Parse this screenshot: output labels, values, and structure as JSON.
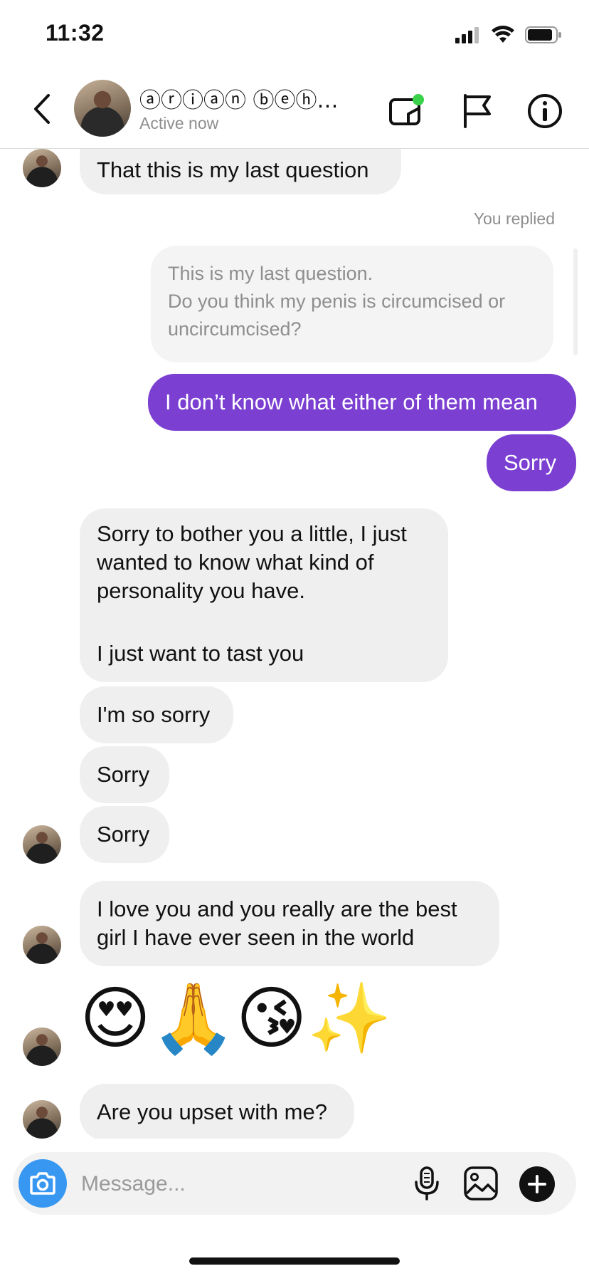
{
  "status_bar": {
    "time": "11:32"
  },
  "header": {
    "name": "ⓐⓡⓘⓐⓝ ⓑⓔⓗ…",
    "status": "Active now",
    "icons": [
      "back-icon",
      "video-call-icon",
      "flag-icon",
      "info-icon"
    ],
    "video_active_color": "#3bd24b"
  },
  "messages": {
    "m1": "That this is my last question",
    "reply_label": "You replied",
    "reply_quote_line1": "This is my last question.",
    "reply_quote_line2": "Do you think my penis is circumcised or uncircumcised?",
    "out1": "I don’t know what either of them mean",
    "out2": "Sorry",
    "m2_line1": "Sorry to bother you a little, I just wanted to know what kind of personality you have.",
    "m2_line2": "I just want to tast you",
    "m3": "I'm so sorry",
    "m4": "Sorry",
    "m5": "Sorry",
    "m6": "I love you and you really are the  best girl I have ever seen in the world",
    "emojis": "😍🙏😘✨",
    "m7": "Are you upset with me?"
  },
  "composer": {
    "placeholder": "Message...",
    "icons": [
      "camera-icon",
      "microphone-icon",
      "gallery-icon",
      "plus-icon"
    ]
  },
  "colors": {
    "outgoing_bubble": "#7b3fd1",
    "incoming_bubble": "#efefef",
    "camera_button": "#3897f0"
  }
}
